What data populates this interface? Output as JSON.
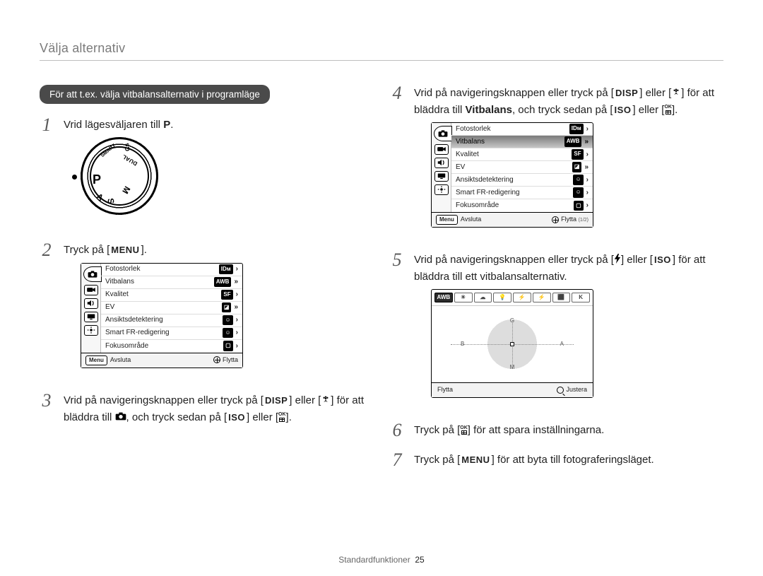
{
  "header": {
    "title": "Välja alternativ"
  },
  "left": {
    "pill": "För att t.ex. välja vitbalansalternativ i programläge",
    "step1": {
      "pre": "Vrid lägesväljaren till ",
      "mode": "P",
      "post": "."
    },
    "step2": {
      "pre": "Tryck på [",
      "key": "MENU",
      "post": "]."
    },
    "step3": {
      "a": "Vrid på navigeringsknappen eller tryck på [",
      "disp": "DISP",
      "b": "] eller [",
      "c": "] för att bläddra till ",
      "d": ", och tryck sedan på [",
      "iso": "ISO",
      "e": "] eller [",
      "f": "]."
    }
  },
  "right": {
    "step4": {
      "a": "Vrid på navigeringsknappen eller tryck på [",
      "disp": "DISP",
      "b": "] eller [",
      "c": "] för att bläddra till ",
      "bold": "Vitbalans",
      "d": ", och tryck sedan på [",
      "iso": "ISO",
      "e": "] eller [",
      "f": "]."
    },
    "step5": {
      "a": "Vrid på navigeringsknappen eller tryck på [",
      "b": "] eller [",
      "iso": "ISO",
      "c": "] för att bläddra till ett vitbalansalternativ."
    },
    "step6": {
      "a": "Tryck på [",
      "b": "] för att spara inställningarna."
    },
    "step7": {
      "a": "Tryck på [",
      "menu": "MENU",
      "b": "] för att byta till fotograferingsläget."
    }
  },
  "dial": {
    "P": "P",
    "A": "A",
    "S": "S",
    "M": "M",
    "DUAL": "DUAL",
    "CS": "Cs",
    "SMART": "SMART"
  },
  "menu": {
    "items": [
      {
        "label": "Fotostorlek",
        "value_icon": "IDM",
        "value_text": "",
        "chev": "›"
      },
      {
        "label": "Vitbalans",
        "value_icon": "AWB",
        "value_text": "",
        "chev": "»"
      },
      {
        "label": "Kvalitet",
        "value_icon": "SF",
        "value_text": "",
        "chev": "›"
      },
      {
        "label": "EV",
        "value_icon": "EV",
        "value_text": "",
        "chev": "»"
      },
      {
        "label": "Ansiktsdetektering",
        "value_icon": "FACE",
        "value_text": "",
        "chev": "›"
      },
      {
        "label": "Smart FR-redigering",
        "value_icon": "SFR",
        "value_text": "",
        "chev": "›"
      },
      {
        "label": "Fokusområde",
        "value_icon": "AF",
        "value_text": "",
        "chev": "›"
      }
    ],
    "footer": {
      "exit": "Avsluta",
      "move": "Flytta",
      "menu_btn": "Menu",
      "page": "(1/2)"
    }
  },
  "wb": {
    "options": [
      "AWB",
      "☀",
      "☁",
      "💡",
      "⚡",
      "⚡",
      "⬛",
      "K"
    ],
    "axes": {
      "g": "G",
      "m": "M",
      "b": "B",
      "a": "A"
    },
    "footer": {
      "move": "Flytta",
      "adjust": "Justera"
    }
  },
  "footer": {
    "section": "Standardfunktioner",
    "page": "25"
  }
}
